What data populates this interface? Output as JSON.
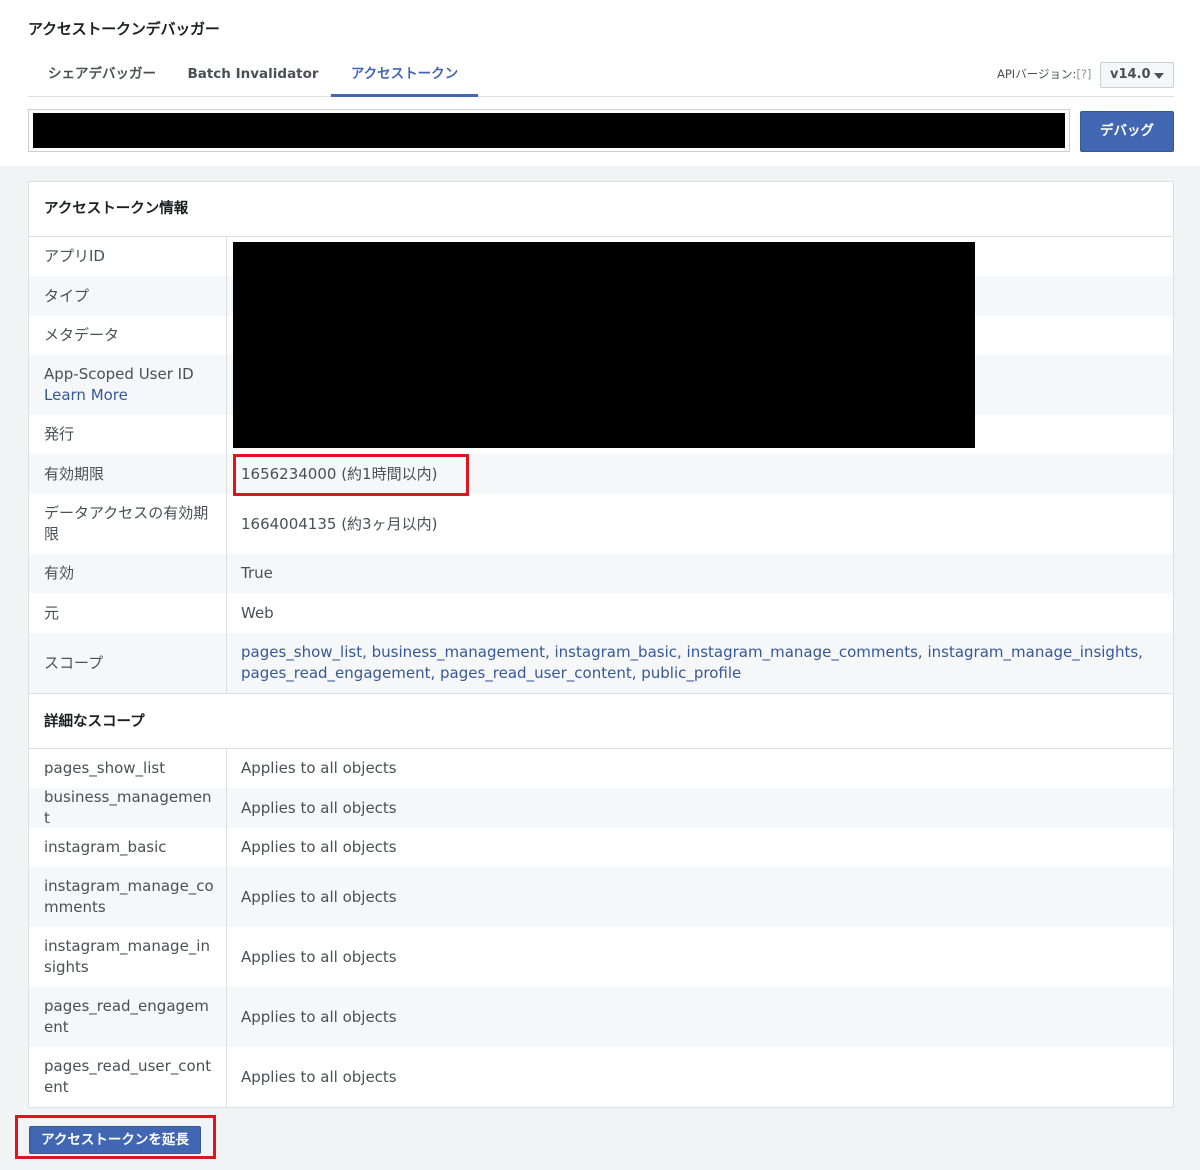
{
  "header": {
    "title": "アクセストークンデバッガー"
  },
  "tabs": [
    {
      "label": "シェアデバッガー"
    },
    {
      "label": "Batch Invalidator"
    },
    {
      "label": "アクセストークン"
    }
  ],
  "api_version": {
    "label": "APIバージョン:",
    "help": "[?]",
    "value": "v14.0"
  },
  "token_input": {
    "value": ""
  },
  "debug_button": {
    "label": "デバッグ"
  },
  "info_section": {
    "title": "アクセストークン情報",
    "rows": [
      {
        "key": "アプリID",
        "value": ""
      },
      {
        "key": "タイプ",
        "value": ""
      },
      {
        "key": "メタデータ",
        "value": ""
      },
      {
        "key": "App-Scoped User ID",
        "key_link": "Learn More",
        "value": ""
      },
      {
        "key": "発行",
        "value": ""
      },
      {
        "key": "有効期限",
        "value": "1656234000 (約1時間以内)"
      },
      {
        "key": "データアクセスの有効期限",
        "value": "1664004135 (約3ヶ月以内)"
      },
      {
        "key": "有効",
        "value": "True"
      },
      {
        "key": "元",
        "value": "Web"
      },
      {
        "key": "スコープ",
        "value": "pages_show_list, business_management, instagram_basic, instagram_manage_comments, instagram_manage_insights, pages_read_engagement, pages_read_user_content, public_profile"
      }
    ]
  },
  "detail_section": {
    "title": "詳細なスコープ",
    "rows": [
      {
        "key": "pages_show_list",
        "value": "Applies to all objects"
      },
      {
        "key": "business_management",
        "value": "Applies to all objects"
      },
      {
        "key": "instagram_basic",
        "value": "Applies to all objects"
      },
      {
        "key": "instagram_manage_comments",
        "value": "Applies to all objects"
      },
      {
        "key": "instagram_manage_insights",
        "value": "Applies to all objects"
      },
      {
        "key": "pages_read_engagement",
        "value": "Applies to all objects"
      },
      {
        "key": "pages_read_user_content",
        "value": "Applies to all objects"
      }
    ]
  },
  "extend_button": {
    "label": "アクセストークンを延長"
  },
  "colors": {
    "accent": "#4267b2",
    "highlight": "#e0141e",
    "link": "#365899"
  }
}
